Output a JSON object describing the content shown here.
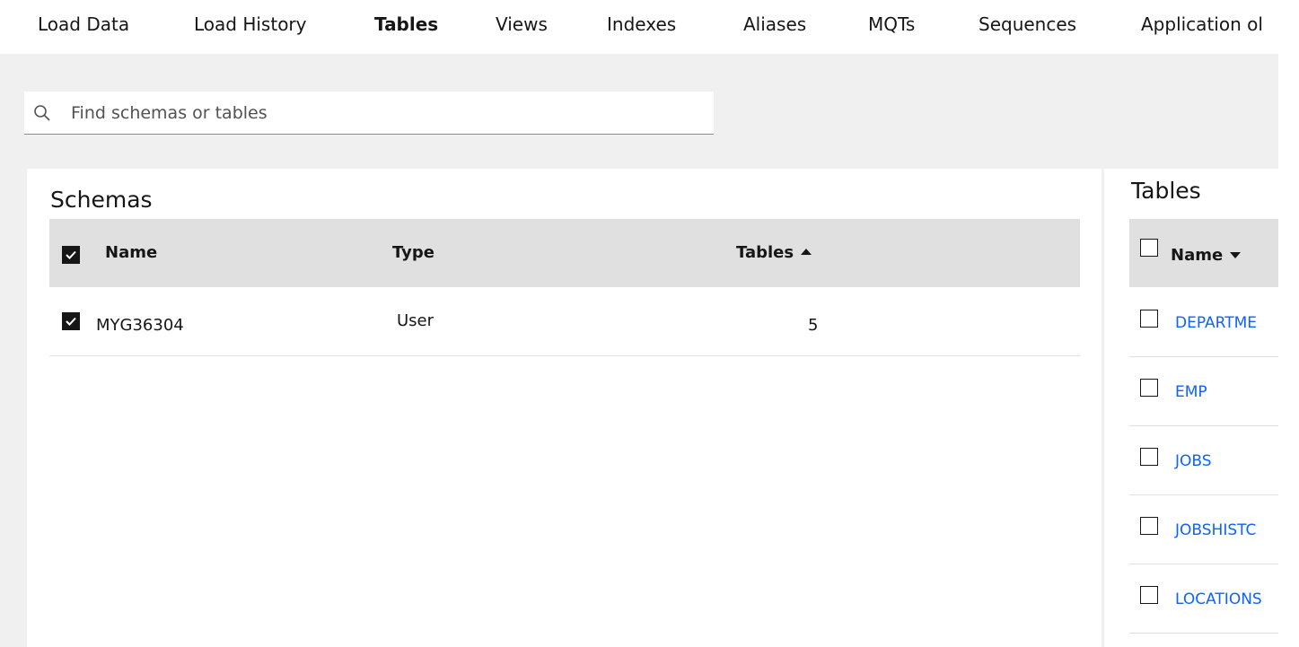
{
  "nav": {
    "tabs": [
      {
        "label": "Load Data",
        "active": false
      },
      {
        "label": "Load History",
        "active": false
      },
      {
        "label": "Tables",
        "active": true
      },
      {
        "label": "Views",
        "active": false
      },
      {
        "label": "Indexes",
        "active": false
      },
      {
        "label": "Aliases",
        "active": false
      },
      {
        "label": "MQTs",
        "active": false
      },
      {
        "label": "Sequences",
        "active": false
      },
      {
        "label": "Application ol",
        "active": false
      }
    ]
  },
  "search": {
    "placeholder": "Find schemas or tables",
    "value": ""
  },
  "schemas": {
    "title": "Schemas",
    "headers": {
      "name": "Name",
      "type": "Type",
      "tables": "Tables"
    },
    "select_all_checked": true,
    "rows": [
      {
        "name": "MYG36304",
        "type": "User",
        "tables": "5",
        "checked": true
      }
    ]
  },
  "tables": {
    "title": "Tables",
    "headers": {
      "name": "Name"
    },
    "select_all_checked": false,
    "rows": [
      {
        "name": "DEPARTME",
        "checked": false
      },
      {
        "name": "EMP",
        "checked": false
      },
      {
        "name": "JOBS",
        "checked": false
      },
      {
        "name": "JOBSHISTC",
        "checked": false
      },
      {
        "name": "LOCATIONS",
        "checked": false
      }
    ]
  },
  "colors": {
    "accent_link": "#0f62fe",
    "header_bg": "#e0e0e0",
    "content_bg": "#f0f0f0"
  }
}
